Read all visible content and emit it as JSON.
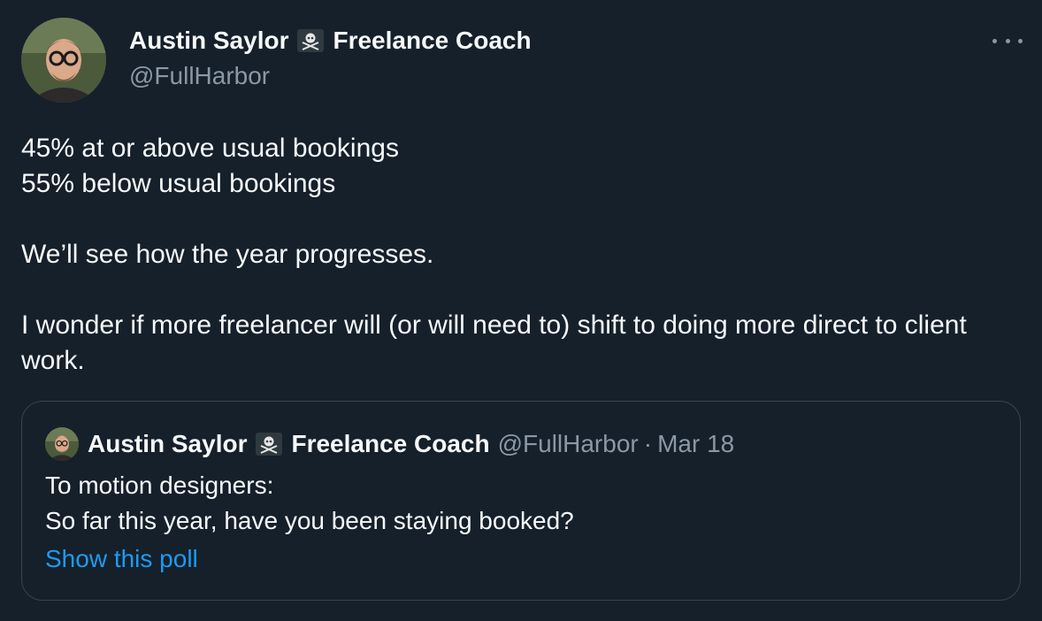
{
  "author": {
    "name": "Austin Saylor",
    "badge_icon": "skull-crossbones-icon",
    "title": "Freelance Coach",
    "handle": "@FullHarbor"
  },
  "body": {
    "line1": "45% at or above usual bookings",
    "line2": "55% below usual bookings",
    "line3": "We’ll see how the year progresses.",
    "line4": "I wonder if more freelancer will (or will need to) shift to doing more direct to client work."
  },
  "quoted": {
    "name": "Austin Saylor",
    "badge_icon": "skull-crossbones-icon",
    "title": "Freelance Coach",
    "handle": "@FullHarbor",
    "separator": "·",
    "date": "Mar 18",
    "line1": "To motion designers:",
    "line2": "So far this year, have you been staying booked?",
    "poll_link": "Show this poll"
  },
  "colors": {
    "background": "#15202b",
    "text": "#f7f9f9",
    "secondary": "#8b98a5",
    "link": "#1d9bf0",
    "border": "#38444d"
  }
}
